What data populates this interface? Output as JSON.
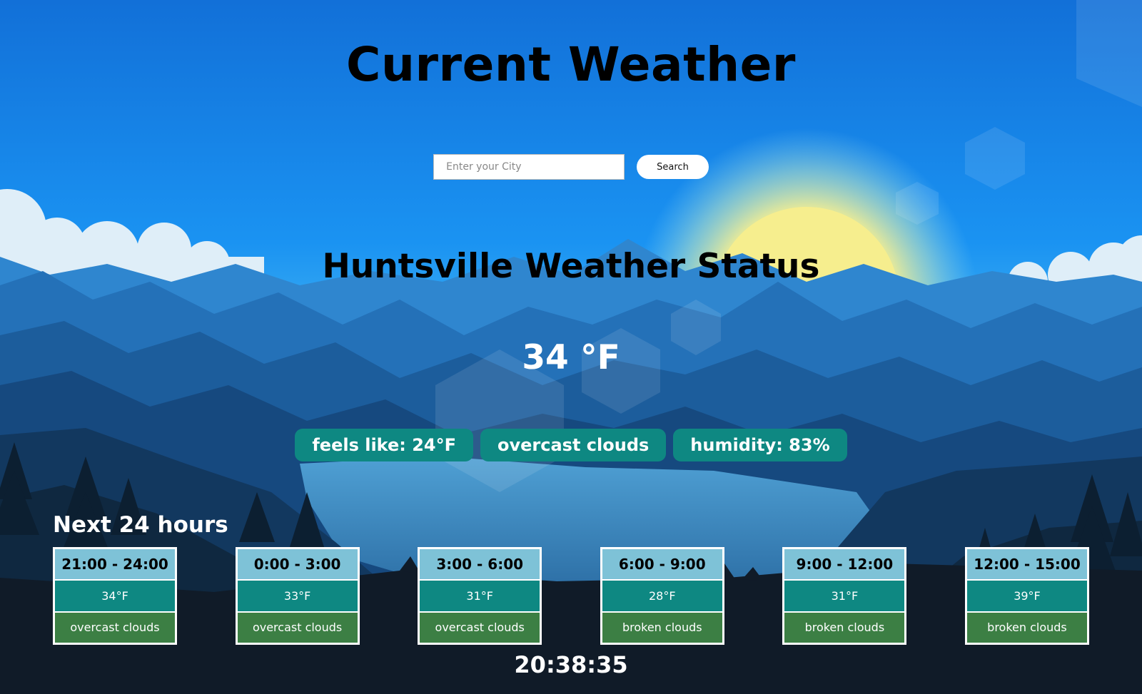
{
  "header": {
    "title": "Current Weather"
  },
  "search": {
    "placeholder": "Enter your City",
    "value": "",
    "button_label": "Search"
  },
  "current": {
    "heading": "Huntsville Weather Status",
    "temperature": "34 °F",
    "feels_like": "feels like: 24°F",
    "condition": "overcast clouds",
    "humidity": "humidity: 83%"
  },
  "forecast": {
    "heading": "Next 24 hours",
    "items": [
      {
        "time": "21:00 - 24:00",
        "temp": "34°F",
        "description": "overcast clouds"
      },
      {
        "time": "0:00 - 3:00",
        "temp": "33°F",
        "description": "overcast clouds"
      },
      {
        "time": "3:00 - 6:00",
        "temp": "31°F",
        "description": "overcast clouds"
      },
      {
        "time": "6:00 - 9:00",
        "temp": "28°F",
        "description": "broken clouds"
      },
      {
        "time": "9:00 - 12:00",
        "temp": "31°F",
        "description": "broken clouds"
      },
      {
        "time": "12:00 - 15:00",
        "temp": "39°F",
        "description": "broken clouds"
      }
    ]
  },
  "clock": {
    "time": "20:38:35"
  },
  "colors": {
    "sky_top": "#1270d8",
    "sky_mid": "#1a93f2",
    "sun": "#f6ee8e",
    "pill": "#0e8882",
    "card_time": "#7ec2d7",
    "card_temp": "#0e8882",
    "card_desc": "#3c7f44"
  }
}
